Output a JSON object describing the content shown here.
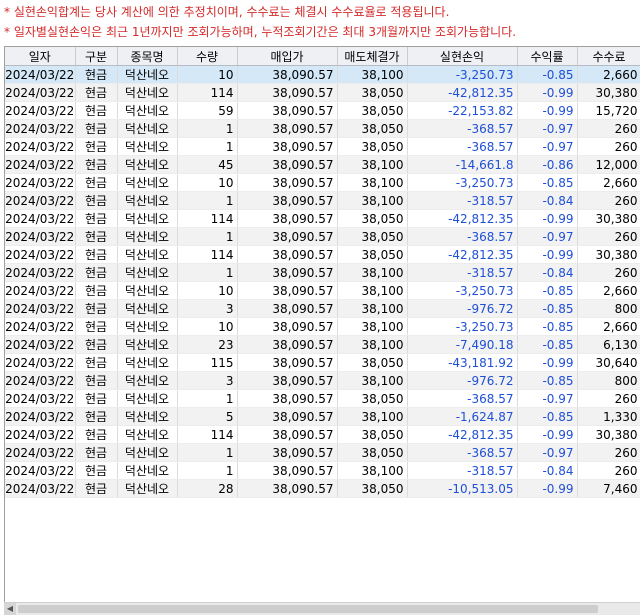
{
  "notices": [
    "* 실현손익합계는 당사 계산에 의한 추정치이며, 수수료는 체결시 수수료율로 적용됩니다.",
    "* 일자별실현손익은 최근 1년까지만 조회가능하며, 누적조회기간은 최대 3개월까지만 조회가능합니다."
  ],
  "table": {
    "headers": [
      "일자",
      "구분",
      "종목명",
      "수량",
      "매입가",
      "매도체결가",
      "실현손익",
      "수익률",
      "수수료"
    ],
    "rows": [
      [
        "2024/03/22",
        "현금",
        "덕산네오",
        "10",
        "38,090.57",
        "38,100",
        "-3,250.73",
        "-0.85",
        "2,660"
      ],
      [
        "2024/03/22",
        "현금",
        "덕산네오",
        "114",
        "38,090.57",
        "38,050",
        "-42,812.35",
        "-0.99",
        "30,380"
      ],
      [
        "2024/03/22",
        "현금",
        "덕산네오",
        "59",
        "38,090.57",
        "38,050",
        "-22,153.82",
        "-0.99",
        "15,720"
      ],
      [
        "2024/03/22",
        "현금",
        "덕산네오",
        "1",
        "38,090.57",
        "38,050",
        "-368.57",
        "-0.97",
        "260"
      ],
      [
        "2024/03/22",
        "현금",
        "덕산네오",
        "1",
        "38,090.57",
        "38,050",
        "-368.57",
        "-0.97",
        "260"
      ],
      [
        "2024/03/22",
        "현금",
        "덕산네오",
        "45",
        "38,090.57",
        "38,100",
        "-14,661.8",
        "-0.86",
        "12,000"
      ],
      [
        "2024/03/22",
        "현금",
        "덕산네오",
        "10",
        "38,090.57",
        "38,100",
        "-3,250.73",
        "-0.85",
        "2,660"
      ],
      [
        "2024/03/22",
        "현금",
        "덕산네오",
        "1",
        "38,090.57",
        "38,100",
        "-318.57",
        "-0.84",
        "260"
      ],
      [
        "2024/03/22",
        "현금",
        "덕산네오",
        "114",
        "38,090.57",
        "38,050",
        "-42,812.35",
        "-0.99",
        "30,380"
      ],
      [
        "2024/03/22",
        "현금",
        "덕산네오",
        "1",
        "38,090.57",
        "38,050",
        "-368.57",
        "-0.97",
        "260"
      ],
      [
        "2024/03/22",
        "현금",
        "덕산네오",
        "114",
        "38,090.57",
        "38,050",
        "-42,812.35",
        "-0.99",
        "30,380"
      ],
      [
        "2024/03/22",
        "현금",
        "덕산네오",
        "1",
        "38,090.57",
        "38,100",
        "-318.57",
        "-0.84",
        "260"
      ],
      [
        "2024/03/22",
        "현금",
        "덕산네오",
        "10",
        "38,090.57",
        "38,100",
        "-3,250.73",
        "-0.85",
        "2,660"
      ],
      [
        "2024/03/22",
        "현금",
        "덕산네오",
        "3",
        "38,090.57",
        "38,100",
        "-976.72",
        "-0.85",
        "800"
      ],
      [
        "2024/03/22",
        "현금",
        "덕산네오",
        "10",
        "38,090.57",
        "38,100",
        "-3,250.73",
        "-0.85",
        "2,660"
      ],
      [
        "2024/03/22",
        "현금",
        "덕산네오",
        "23",
        "38,090.57",
        "38,100",
        "-7,490.18",
        "-0.85",
        "6,130"
      ],
      [
        "2024/03/22",
        "현금",
        "덕산네오",
        "115",
        "38,090.57",
        "38,050",
        "-43,181.92",
        "-0.99",
        "30,640"
      ],
      [
        "2024/03/22",
        "현금",
        "덕산네오",
        "3",
        "38,090.57",
        "38,100",
        "-976.72",
        "-0.85",
        "800"
      ],
      [
        "2024/03/22",
        "현금",
        "덕산네오",
        "1",
        "38,090.57",
        "38,050",
        "-368.57",
        "-0.97",
        "260"
      ],
      [
        "2024/03/22",
        "현금",
        "덕산네오",
        "5",
        "38,090.57",
        "38,100",
        "-1,624.87",
        "-0.85",
        "1,330"
      ],
      [
        "2024/03/22",
        "현금",
        "덕산네오",
        "114",
        "38,090.57",
        "38,050",
        "-42,812.35",
        "-0.99",
        "30,380"
      ],
      [
        "2024/03/22",
        "현금",
        "덕산네오",
        "1",
        "38,090.57",
        "38,050",
        "-368.57",
        "-0.97",
        "260"
      ],
      [
        "2024/03/22",
        "현금",
        "덕산네오",
        "1",
        "38,090.57",
        "38,100",
        "-318.57",
        "-0.84",
        "260"
      ],
      [
        "2024/03/22",
        "현금",
        "덕산네오",
        "28",
        "38,090.57",
        "38,050",
        "-10,513.05",
        "-0.99",
        "7,460"
      ]
    ]
  },
  "colors": {
    "notice": "#d42a2a",
    "negative": "#1f4fd6",
    "selected_row": "#d4e8f7",
    "alt_row": "#f2f2f2"
  },
  "scrollbar": {
    "left_arrow_icon": "left-arrow-icon"
  }
}
